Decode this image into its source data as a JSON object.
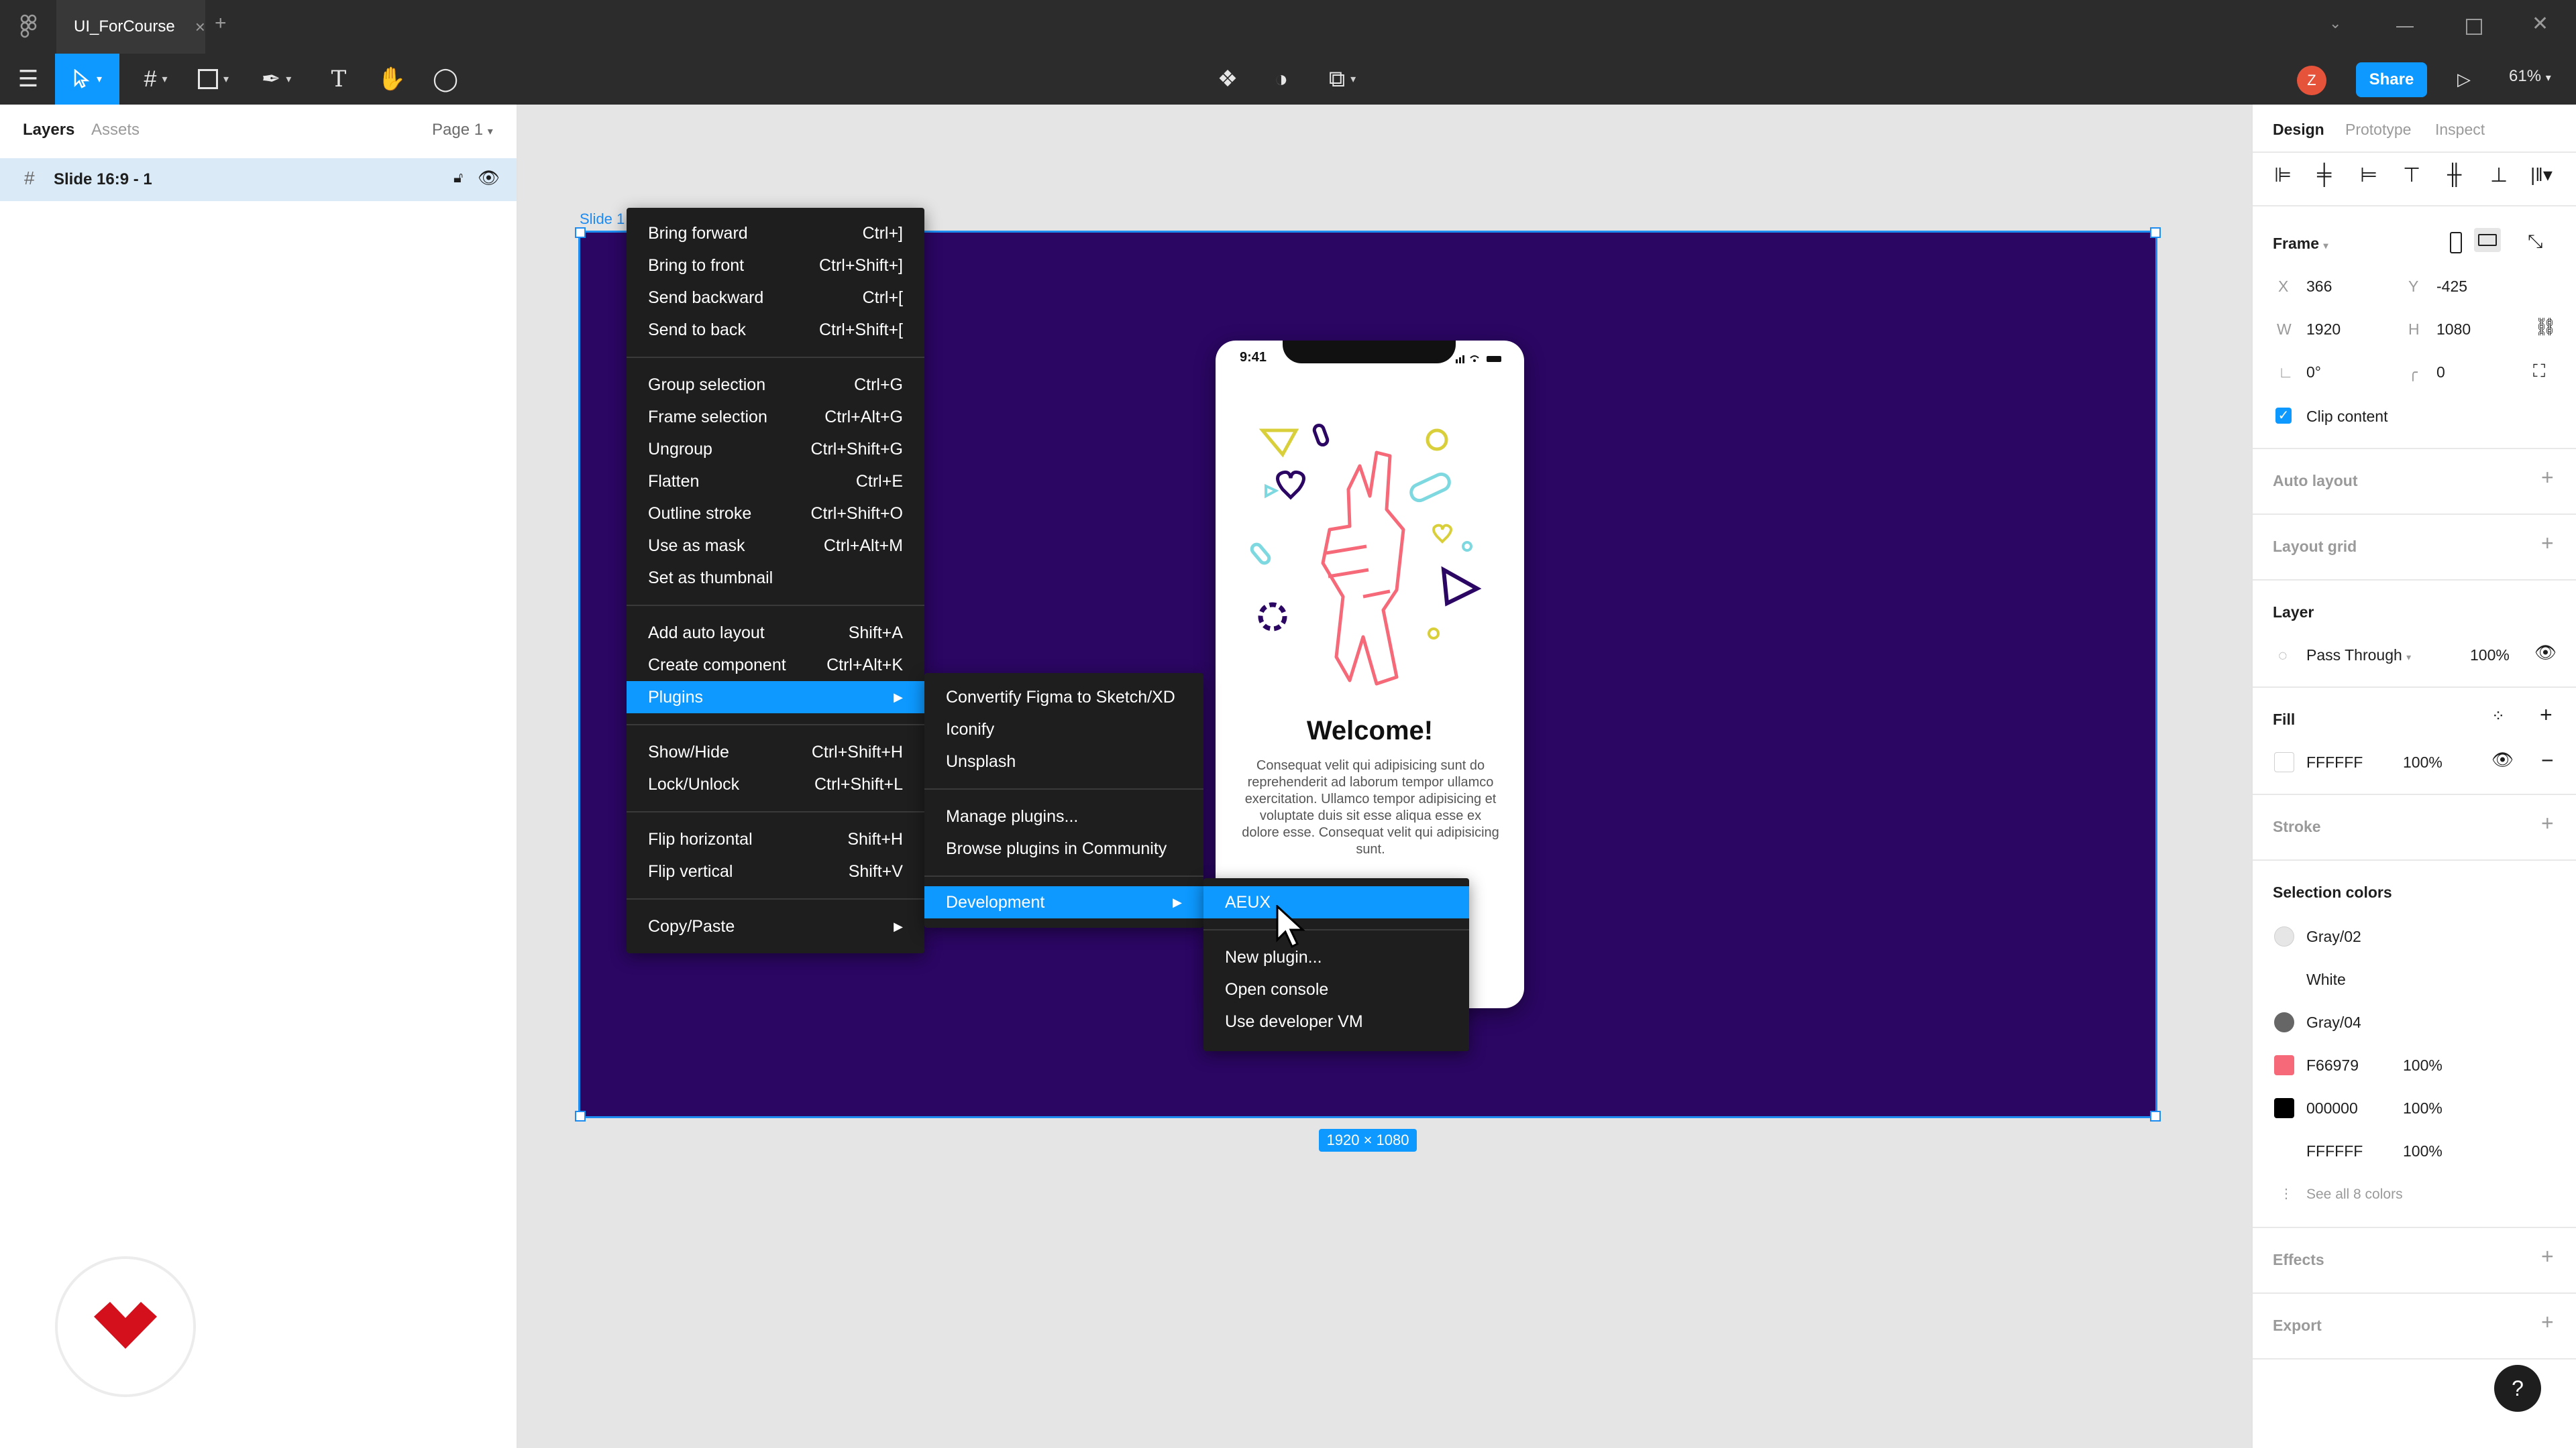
{
  "titlebar": {
    "tab_name": "UI_ForCourse",
    "tab_close": "×",
    "new_tab": "+"
  },
  "toolbar": {
    "share_label": "Share",
    "avatar_letter": "Z",
    "zoom": "61%"
  },
  "left_panel": {
    "tabs": [
      "Layers",
      "Assets"
    ],
    "page_selector": "Page 1",
    "layer": "Slide 16:9 - 1"
  },
  "canvas": {
    "slide_label": "Slide 1",
    "dimension_badge": "1920 × 1080",
    "phone": {
      "time": "9:41",
      "title": "Welcome!",
      "body": "Consequat velit qui adipisicing sunt do reprehenderit ad laborum tempor ullamco exercitation. Ullamco tempor adipisicing et voluptate duis sit esse aliqua esse ex dolore esse. Consequat velit qui adipisicing sunt."
    }
  },
  "context_menu": {
    "items": [
      {
        "label": "Bring forward",
        "shortcut": "Ctrl+]"
      },
      {
        "label": "Bring to front",
        "shortcut": "Ctrl+Shift+]"
      },
      {
        "label": "Send backward",
        "shortcut": "Ctrl+["
      },
      {
        "label": "Send to back",
        "shortcut": "Ctrl+Shift+["
      },
      {
        "label": "Group selection",
        "shortcut": "Ctrl+G"
      },
      {
        "label": "Frame selection",
        "shortcut": "Ctrl+Alt+G"
      },
      {
        "label": "Ungroup",
        "shortcut": "Ctrl+Shift+G"
      },
      {
        "label": "Flatten",
        "shortcut": "Ctrl+E"
      },
      {
        "label": "Outline stroke",
        "shortcut": "Ctrl+Shift+O"
      },
      {
        "label": "Use as mask",
        "shortcut": "Ctrl+Alt+M"
      },
      {
        "label": "Set as thumbnail",
        "shortcut": ""
      },
      {
        "label": "Add auto layout",
        "shortcut": "Shift+A"
      },
      {
        "label": "Create component",
        "shortcut": "Ctrl+Alt+K"
      },
      {
        "label": "Plugins",
        "shortcut": ""
      },
      {
        "label": "Show/Hide",
        "shortcut": "Ctrl+Shift+H"
      },
      {
        "label": "Lock/Unlock",
        "shortcut": "Ctrl+Shift+L"
      },
      {
        "label": "Flip horizontal",
        "shortcut": "Shift+H"
      },
      {
        "label": "Flip vertical",
        "shortcut": "Shift+V"
      },
      {
        "label": "Copy/Paste",
        "shortcut": ""
      }
    ]
  },
  "plugins_menu": {
    "items": [
      "Convertify Figma to Sketch/XD",
      "Iconify",
      "Unsplash",
      "Manage plugins...",
      "Browse plugins in Community",
      "Development"
    ]
  },
  "development_menu": {
    "items": [
      "AEUX",
      "New plugin...",
      "Open console",
      "Use developer VM"
    ]
  },
  "right_panel": {
    "tabs": [
      "Design",
      "Prototype",
      "Inspect"
    ],
    "frame_label": "Frame",
    "x_label": "X",
    "x_value": "366",
    "y_label": "Y",
    "y_value": "-425",
    "w_label": "W",
    "w_value": "1920",
    "h_label": "H",
    "h_value": "1080",
    "rotation": "0°",
    "radius": "0",
    "clip_content": "Clip content",
    "auto_layout": "Auto layout",
    "layout_grid": "Layout grid",
    "layer_title": "Layer",
    "blend_mode": "Pass Through",
    "layer_opacity": "100%",
    "fill_title": "Fill",
    "fill_hex": "FFFFFF",
    "fill_opacity": "100%",
    "stroke_title": "Stroke",
    "selection_colors_title": "Selection colors",
    "selection_colors": [
      {
        "name": "Gray/02",
        "opacity": "",
        "color": "#e6e6e6",
        "round": true
      },
      {
        "name": "White",
        "opacity": "",
        "color": "#ffffff",
        "round": true
      },
      {
        "name": "Gray/04",
        "opacity": "",
        "color": "#666666",
        "round": true
      },
      {
        "name": "F66979",
        "opacity": "100%",
        "color": "#f66979",
        "round": false
      },
      {
        "name": "000000",
        "opacity": "100%",
        "color": "#000000",
        "round": false
      },
      {
        "name": "FFFFFF",
        "opacity": "100%",
        "color": "#ffffff",
        "round": false
      }
    ],
    "see_all": "See all 8 colors",
    "effects_title": "Effects",
    "export_title": "Export",
    "help": "?"
  }
}
